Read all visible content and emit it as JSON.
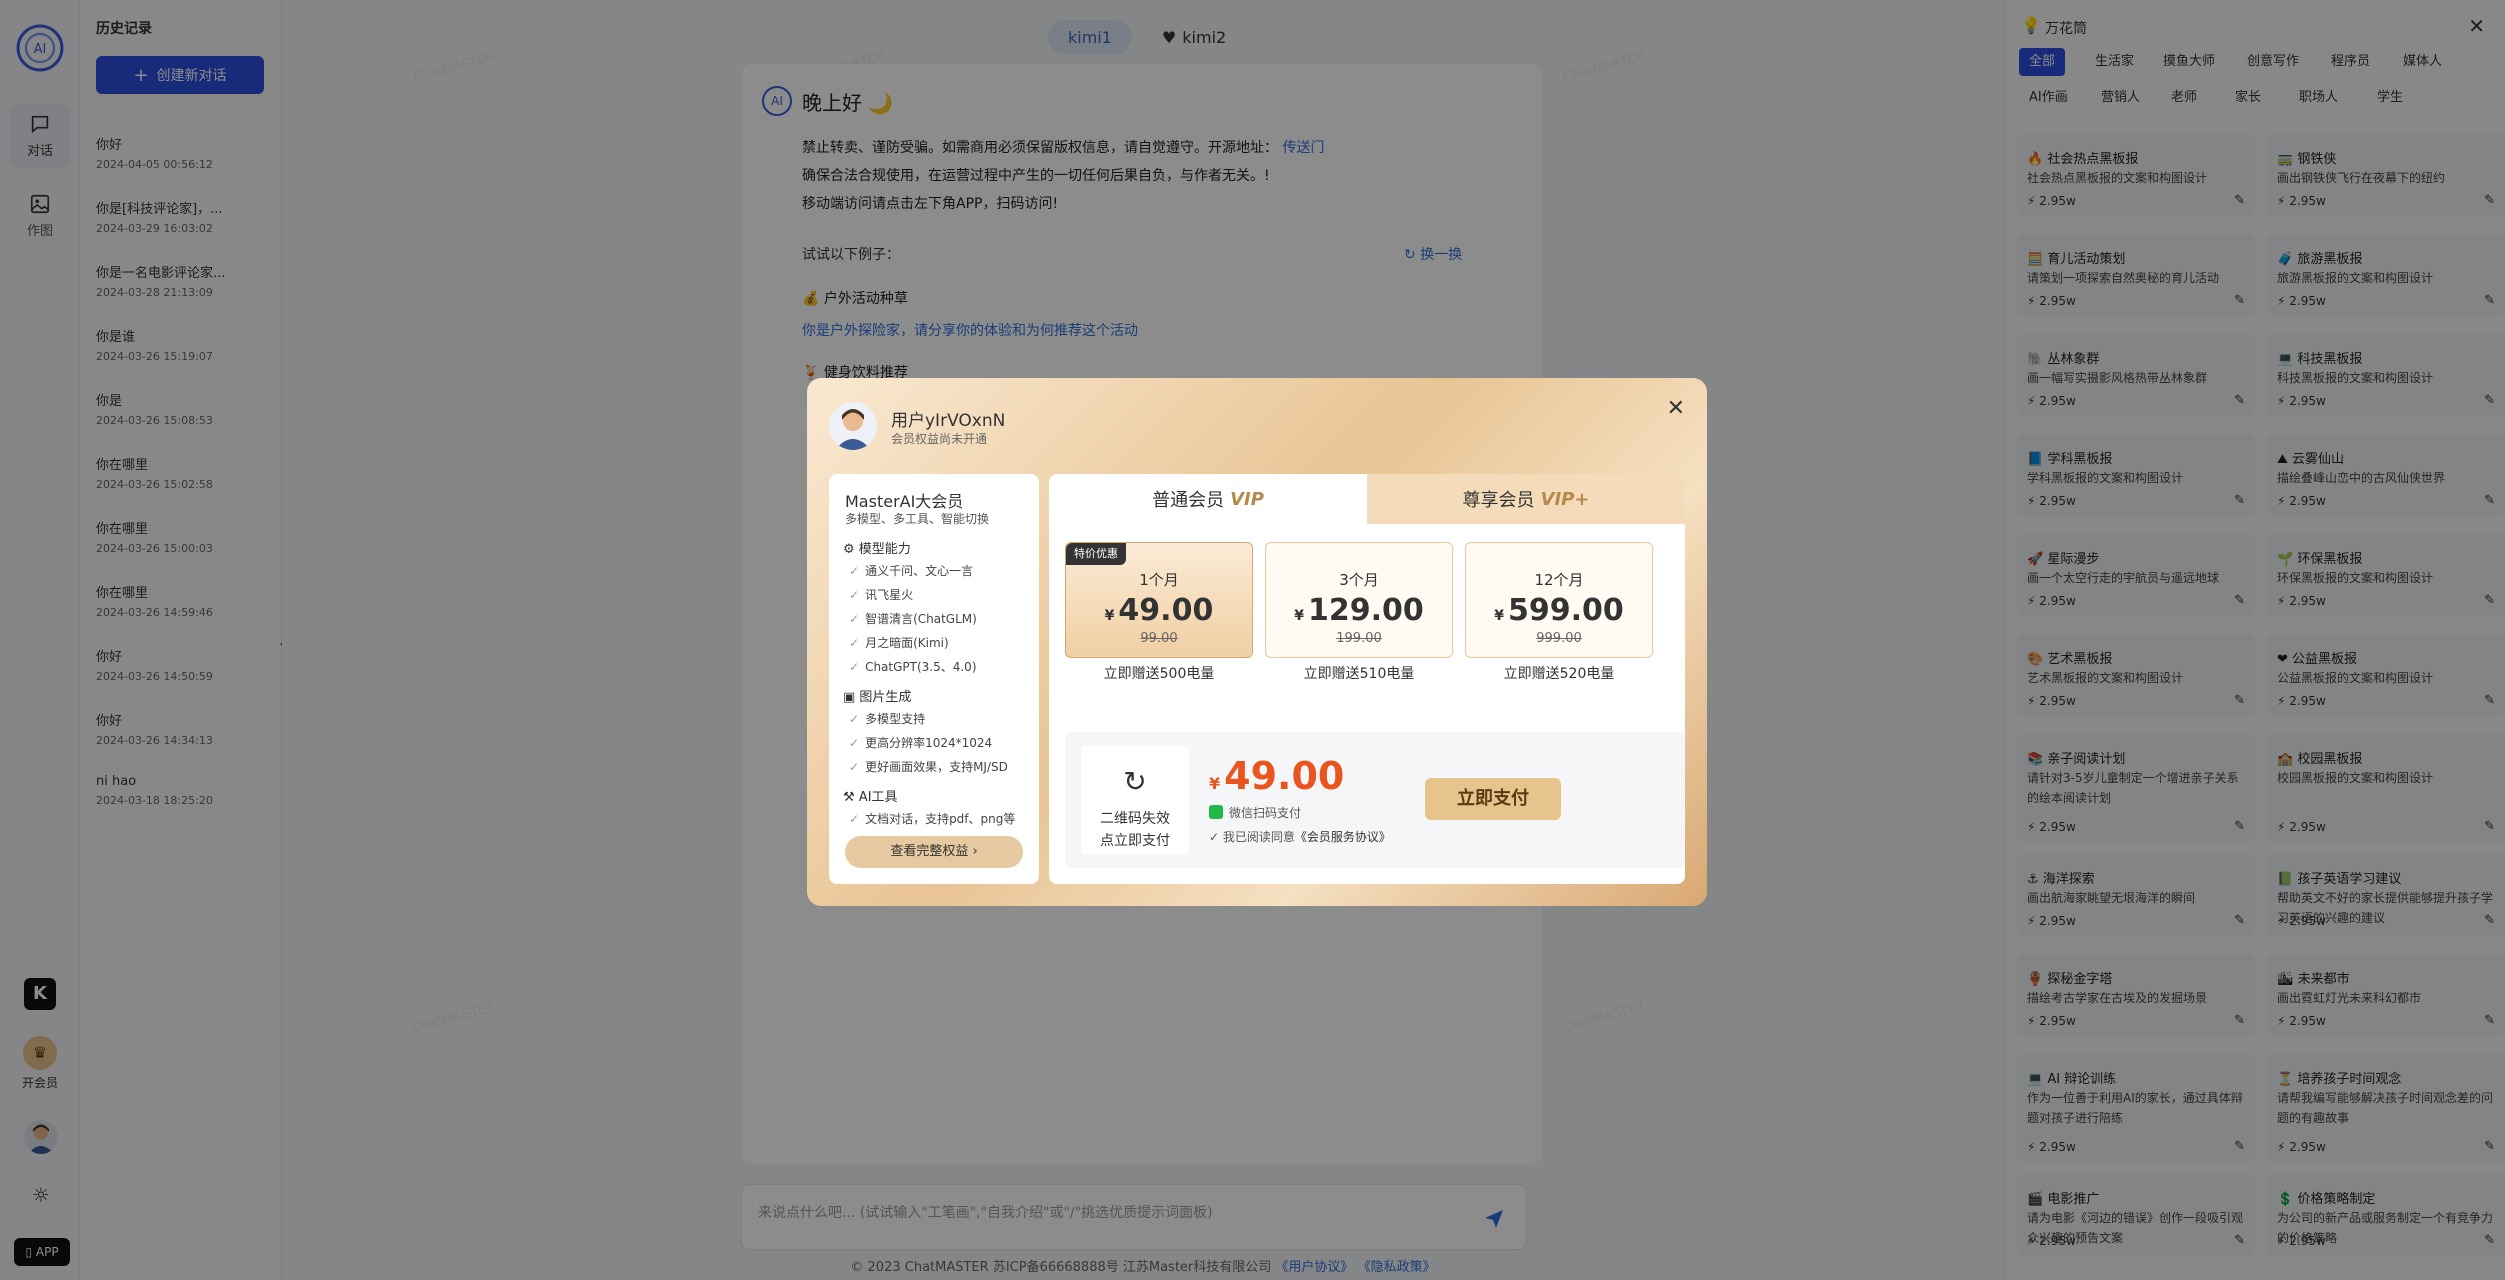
{
  "rail": {
    "items": [
      {
        "label": "对话"
      },
      {
        "label": "作图"
      }
    ],
    "member_label": "开会员",
    "app_label": "APP"
  },
  "history": {
    "title": "历史记录",
    "new_chat": "创建新对话",
    "items": [
      {
        "title": "你好",
        "date": "2024-04-05 00:56:12"
      },
      {
        "title": "你是[科技评论家]，...",
        "date": "2024-03-29 16:03:02"
      },
      {
        "title": "你是一名电影评论家...",
        "date": "2024-03-28 21:13:09"
      },
      {
        "title": "你是谁",
        "date": "2024-03-26 15:19:07"
      },
      {
        "title": "你是",
        "date": "2024-03-26 15:08:53"
      },
      {
        "title": "你在哪里",
        "date": "2024-03-26 15:02:58"
      },
      {
        "title": "你在哪里",
        "date": "2024-03-26 15:00:03"
      },
      {
        "title": "你在哪里",
        "date": "2024-03-26 14:59:46"
      },
      {
        "title": "你好",
        "date": "2024-03-26 14:50:59"
      },
      {
        "title": "你好",
        "date": "2024-03-26 14:34:13"
      },
      {
        "title": "ni hao",
        "date": "2024-03-18 18:25:20"
      }
    ]
  },
  "main": {
    "tabs": [
      {
        "label": "kimi1"
      },
      {
        "label": "kimi2"
      }
    ],
    "greeting": "晚上好 🌙",
    "notice_line1": "禁止转卖、谨防受骗。如需商用必须保留版权信息，请自觉遵守。开源地址：",
    "notice_link": "传送门",
    "notice_line2": "确保合法合规使用，在运营过程中产生的一切任何后果自负，与作者无关。!",
    "notice_line3": "移动端访问请点击左下角APP，扫码访问!",
    "try_label": "试试以下例子：",
    "swap_label": "换一换",
    "cat1": "💰 户外活动种草",
    "ex1": "你是户外探险家，请分享你的体验和为何推荐这个活动",
    "cat2": "🍹 健身饮料推荐",
    "input_placeholder": "来说点什么吧... (试试输入\"工笔画\",\"自我介绍\"或\"/\"挑选优质提示词面板)",
    "footer_text": "© 2023 ChatMASTER 苏ICP备66668888号 江苏Master科技有限公司",
    "footer_link1": "《用户协议》",
    "footer_link2": "《隐私政策》",
    "watermark": "ChatMASTER"
  },
  "right_panel": {
    "title": "万花筒",
    "filters": [
      "全部",
      "生活家",
      "摸鱼大师",
      "创意写作",
      "程序员",
      "媒体人",
      "AI作画",
      "营销人",
      "老师",
      "家长",
      "职场人",
      "学生"
    ],
    "cards": [
      {
        "title": "🔥 社会热点黑板报",
        "desc": "社会热点黑板报的文案和构图设计",
        "metric": "2.95w"
      },
      {
        "title": "🚃 钢铁侠",
        "desc": "画出钢铁侠飞行在夜幕下的纽约",
        "metric": "2.95w"
      },
      {
        "title": "🧮 育儿活动策划",
        "desc": "请策划一项探索自然奥秘的育儿活动",
        "metric": "2.95w"
      },
      {
        "title": "🧳 旅游黑板报",
        "desc": "旅游黑板报的文案和构图设计",
        "metric": "2.95w"
      },
      {
        "title": "🐘 丛林象群",
        "desc": "画一幅写实摄影风格热带丛林象群",
        "metric": "2.95w"
      },
      {
        "title": "💻 科技黑板报",
        "desc": "科技黑板报的文案和构图设计",
        "metric": "2.95w"
      },
      {
        "title": "📘 学科黑板报",
        "desc": "学科黑板报的文案和构图设计",
        "metric": "2.95w"
      },
      {
        "title": "⛰ 云雾仙山",
        "desc": "描绘叠峰山峦中的古风仙侠世界",
        "metric": "2.95w"
      },
      {
        "title": "🚀 星际漫步",
        "desc": "画一个太空行走的宇航员与遥远地球",
        "metric": "2.95w"
      },
      {
        "title": "🌱 环保黑板报",
        "desc": "环保黑板报的文案和构图设计",
        "metric": "2.95w"
      },
      {
        "title": "🎨 艺术黑板报",
        "desc": "艺术黑板报的文案和构图设计",
        "metric": "2.95w"
      },
      {
        "title": "❤ 公益黑板报",
        "desc": "公益黑板报的文案和构图设计",
        "metric": "2.95w"
      },
      {
        "title": "📚 亲子阅读计划",
        "desc": "请针对3-5岁儿童制定一个增进亲子关系的绘本阅读计划",
        "metric": "2.95w"
      },
      {
        "title": "🏫 校园黑板报",
        "desc": "校园黑板报的文案和构图设计",
        "metric": "2.95w"
      },
      {
        "title": "⚓ 海洋探索",
        "desc": "画出航海家眺望无垠海洋的瞬间",
        "metric": "2.95w"
      },
      {
        "title": "📗 孩子英语学习建议",
        "desc": "帮助英文不好的家长提供能够提升孩子学习英语的兴趣的建议",
        "metric": "2.95w"
      },
      {
        "title": "🏺 探秘金字塔",
        "desc": "描绘考古学家在古埃及的发掘场景",
        "metric": "2.95w"
      },
      {
        "title": "🏙 未来都市",
        "desc": "画出霓虹灯光未来科幻都市",
        "metric": "2.95w"
      },
      {
        "title": "💻 AI 辩论训练",
        "desc": "作为一位善于利用AI的家长，通过具体辩题对孩子进行陪练",
        "metric": "2.95w"
      },
      {
        "title": "⏳ 培养孩子时间观念",
        "desc": "请帮我编写能够解决孩子时间观念差的问题的有趣故事",
        "metric": "2.95w"
      },
      {
        "title": "🎬 电影推广",
        "desc": "请为电影《河边的错误》创作一段吸引观众兴趣的预告文案",
        "metric": "2.95w"
      },
      {
        "title": "💲 价格策略制定",
        "desc": "为公司的新产品或服务制定一个有竞争力的价格策略",
        "metric": "2.95w"
      }
    ]
  },
  "modal": {
    "user_name": "用户yIrVOxnN",
    "user_status": "会员权益尚未开通",
    "perks": {
      "title": "MasterAI大会员",
      "subtitle": "多模型、多工具、智能切换",
      "sections": [
        {
          "title": "模型能力",
          "items": [
            "通义千问、文心一言",
            "讯飞星火",
            "智谱清言(ChatGLM)",
            "月之暗面(Kimi)",
            "ChatGPT(3.5、4.0)"
          ]
        },
        {
          "title": "图片生成",
          "items": [
            "多模型支持",
            "更高分辨率1024*1024",
            "更好画面效果，支持MJ/SD"
          ]
        },
        {
          "title": "AI工具",
          "items": [
            "文档对话，支持pdf、png等"
          ]
        }
      ],
      "more": "查看完整权益 ›"
    },
    "tabs": [
      {
        "label": "普通会员",
        "vip": "VIP"
      },
      {
        "label": "尊享会员",
        "vip": "VIP+"
      }
    ],
    "badge": "特价优惠",
    "plans": [
      {
        "duration": "1个月",
        "currency": "¥",
        "price": "49.00",
        "original": "99.00",
        "bonus": "立即赠送500电量"
      },
      {
        "duration": "3个月",
        "currency": "¥",
        "price": "129.00",
        "original": "199.00",
        "bonus": "立即赠送510电量"
      },
      {
        "duration": "12个月",
        "currency": "¥",
        "price": "599.00",
        "original": "999.00",
        "bonus": "立即赠送520电量"
      }
    ],
    "pay": {
      "qr_line1": "二维码失效",
      "qr_line2": "点立即支付",
      "currency": "¥",
      "amount": "49.00",
      "method": "微信扫码支付",
      "agree": "我已阅读同意",
      "agree_link": "《会员服务协议》",
      "button": "立即支付"
    }
  }
}
